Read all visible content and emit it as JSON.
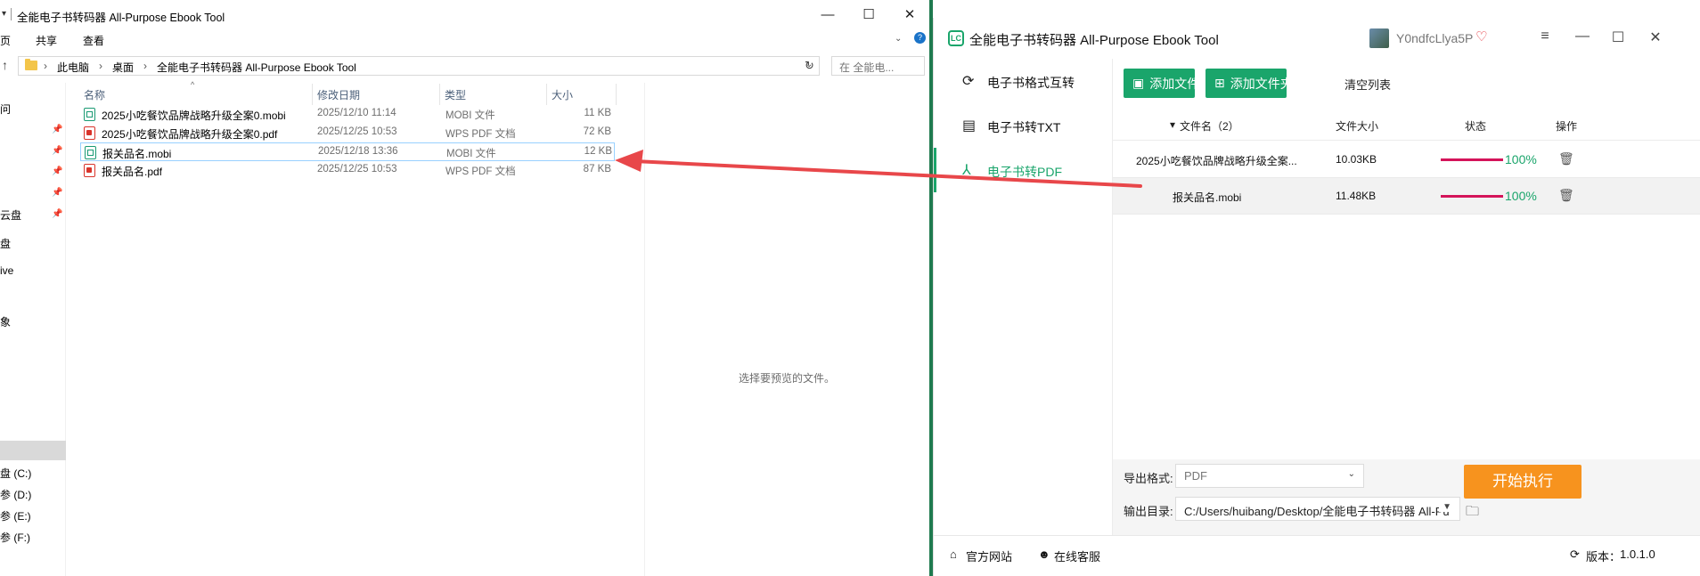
{
  "explorer": {
    "title": "全能电子书转码器 All-Purpose Ebook Tool",
    "window_controls": {
      "minimize": "—",
      "maximize": "☐",
      "close": "✕"
    },
    "ribbon": {
      "tab_page": "页",
      "tab_share": "共享",
      "tab_view": "查看"
    },
    "address": {
      "crumbs": [
        "此电脑",
        "桌面",
        "全能电子书转码器 All-Purpose Ebook Tool"
      ],
      "search_placeholder": "在 全能电..."
    },
    "nav": {
      "items": [
        "问",
        "云盘",
        "盘",
        "ive",
        "象",
        "盘 (C:)",
        "参 (D:)",
        "参 (E:)",
        "参 (F:)"
      ]
    },
    "columns": {
      "name": "名称",
      "date": "修改日期",
      "type": "类型",
      "size": "大小"
    },
    "files": [
      {
        "name": "2025小吃餐饮品牌战略升级全案0.mobi",
        "date": "2025/12/10 11:14",
        "type": "MOBI 文件",
        "size": "11 KB",
        "kind": "mobi",
        "selected": false
      },
      {
        "name": "2025小吃餐饮品牌战略升级全案0.pdf",
        "date": "2025/12/25 10:53",
        "type": "WPS PDF 文档",
        "size": "72 KB",
        "kind": "pdf",
        "selected": false
      },
      {
        "name": "报关品名.mobi",
        "date": "2025/12/18 13:36",
        "type": "MOBI 文件",
        "size": "12 KB",
        "kind": "mobi",
        "selected": true
      },
      {
        "name": "报关品名.pdf",
        "date": "2025/12/25 10:53",
        "type": "WPS PDF 文档",
        "size": "87 KB",
        "kind": "pdf",
        "selected": false
      }
    ],
    "preview_text": "选择要预览的文件。"
  },
  "app": {
    "logo": "LC",
    "title": "全能电子书转码器 All-Purpose Ebook Tool",
    "username": "Y0ndfcLlya5P",
    "icons": {
      "vip": "vip-heart-icon",
      "menu": "menu-icon",
      "minimize": "minimize-icon",
      "maximize": "maximize-icon",
      "close": "close-icon"
    },
    "sidebar": [
      {
        "label": "电子书格式互转",
        "icon": "refresh-icon",
        "active": false
      },
      {
        "label": "电子书转TXT",
        "icon": "document-icon",
        "active": false
      },
      {
        "label": "电子书转PDF",
        "icon": "pdf-icon",
        "active": true
      }
    ],
    "toolbar": {
      "add_file": "添加文件",
      "add_folder": "添加文件夹",
      "clear_list": "清空列表"
    },
    "table": {
      "headers": {
        "name": "文件名（2）",
        "size": "文件大小",
        "status": "状态",
        "action": "操作"
      },
      "rows": [
        {
          "name": "2025小吃餐饮品牌战略升级全案...",
          "size": "10.03KB",
          "progress": 1.0,
          "status": "100%"
        },
        {
          "name": "报关品名.mobi",
          "size": "11.48KB",
          "progress": 1.0,
          "status": "100%"
        }
      ]
    },
    "export": {
      "format_label": "导出格式:",
      "format_value": "PDF",
      "dir_label": "输出目录:",
      "dir_value": "C:/Users/huibang/Desktop/全能电子书转码器 All-Pu",
      "start": "开始执行"
    },
    "footer": {
      "website": "官方网站",
      "support": "在线客服",
      "version_label": "版本：",
      "version": "1.0.1.0"
    },
    "colors": {
      "accent": "#1aa56b",
      "start": "#f7931e",
      "progress": "#d4145a",
      "arrow": "#e8474a"
    }
  }
}
